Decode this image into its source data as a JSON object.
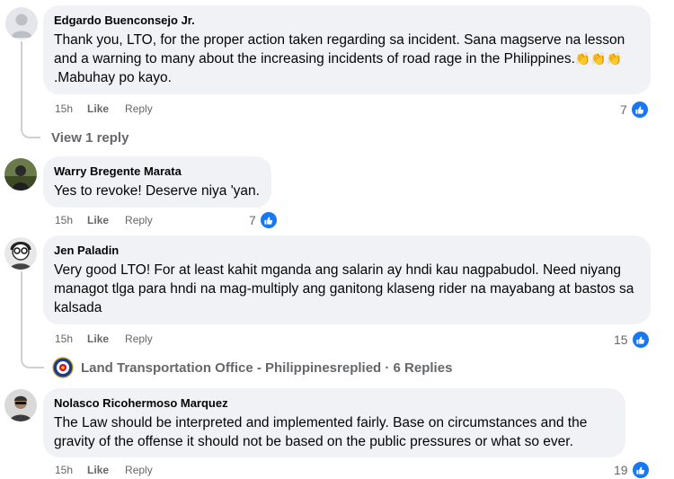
{
  "comments": [
    {
      "author": "Edgardo Buenconsejo Jr.",
      "text": "Thank you, LTO, for the proper action taken regarding sa incident. Sana magserve na lesson and a warning to many about the increasing incidents of road rage in the Philippines.",
      "text_suffix": ".Mabuhay po kayo.",
      "time": "15h",
      "like_label": "Like",
      "reply_label": "Reply",
      "reaction_count": "7",
      "avatar": "default-avatar-icon"
    },
    {
      "author": "Warry Bregente Marata",
      "text": "Yes to revoke! Deserve niya 'yan.",
      "time": "15h",
      "like_label": "Like",
      "reply_label": "Reply",
      "reaction_count": "7",
      "avatar": "profile-photo"
    },
    {
      "author": "Jen Paladin",
      "text": "Very good LTO! For at least kahit mganda ang salarin ay hndi kau nagpabudol. Need niyang managot tlga para hndi na mag-multiply ang ganitong klaseng rider na mayabang at bastos sa kalsada",
      "time": "15h",
      "like_label": "Like",
      "reply_label": "Reply",
      "reaction_count": "15",
      "avatar": "profile-photo"
    },
    {
      "author": "Nolasco Ricohermoso Marquez",
      "text": "The Law should be interpreted and implemented fairly. Base on circumstances and the gravity of the offense it should not be based on the public pressures or what so ever.",
      "time": "15h",
      "like_label": "Like",
      "reply_label": "Reply",
      "reaction_count": "19",
      "avatar": "profile-photo"
    }
  ],
  "view_replies": "View 1 reply",
  "page_reply": {
    "page_name": "Land Transportation Office - Philippines",
    "replied_text": " replied · 6 Replies"
  },
  "colors": {
    "bubble": "#f0f2f5",
    "meta": "#65676b",
    "like_blue": "#1877f2"
  }
}
